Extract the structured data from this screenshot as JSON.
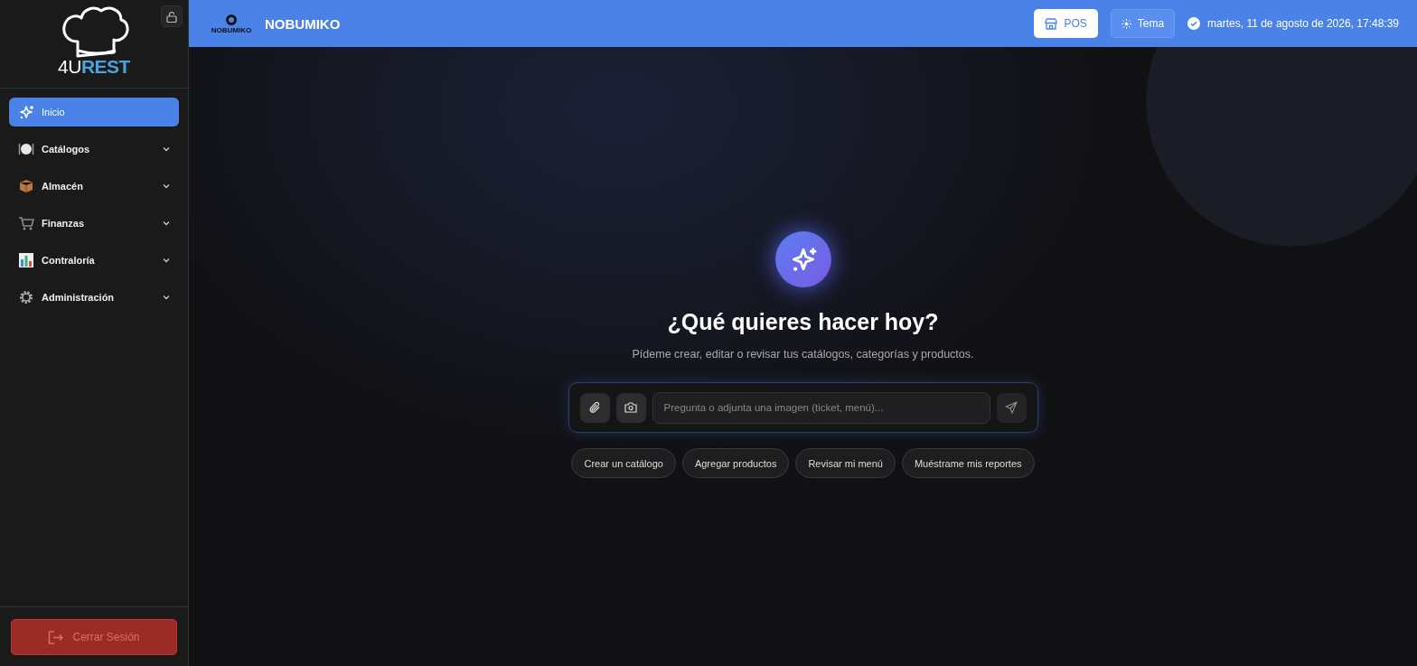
{
  "sidebar": {
    "logo": {
      "prefix": "4U",
      "suffix": "REST"
    },
    "items": [
      {
        "label": "Inicio",
        "kind": "sparkle",
        "selected": true,
        "expandable": false
      },
      {
        "label": "Catálogos",
        "kind": "plate",
        "selected": false,
        "expandable": true
      },
      {
        "label": "Almacén",
        "kind": "box",
        "selected": false,
        "expandable": true
      },
      {
        "label": "Finanzas",
        "kind": "cart",
        "selected": false,
        "expandable": true
      },
      {
        "label": "Contraloría",
        "kind": "chart",
        "selected": false,
        "expandable": true
      },
      {
        "label": "Administración",
        "kind": "gear",
        "selected": false,
        "expandable": true
      }
    ],
    "logout": "Cerrar Sesión"
  },
  "header": {
    "brand_logo_text": "NOBUMIKO",
    "title": "NOBUMIKO",
    "pos_button": "POS",
    "theme_button": "Tema",
    "datetime": "martes, 11 de agosto de 2026, 17:48:39"
  },
  "assistant": {
    "heading": "¿Qué quieres hacer hoy?",
    "subheading": "Pídeme crear, editar o revisar tus catálogos, categorías y productos.",
    "input": {
      "placeholder": "Pregunta o adjunta una imagen (ticket, menú)..."
    },
    "suggestions": [
      "Crear un catálogo",
      "Agregar productos",
      "Revisar mi menú",
      "Muéstrame mis reportes"
    ]
  }
}
